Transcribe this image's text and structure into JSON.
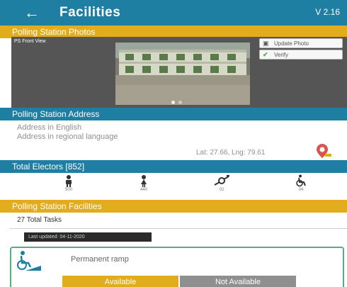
{
  "appbar": {
    "title": "Facilities",
    "version": "V 2.16"
  },
  "photos_section": {
    "title": "Polling Station Photos",
    "caption": "PS Front View",
    "update_label": "Update Photo",
    "verify_label": "Verify",
    "carousel_pages": 2
  },
  "address_section": {
    "title": "Polling Station Address",
    "address_english": "Address in English",
    "address_regional": "Address in regional language",
    "latlng": "Lat: 27.66, Lng: 79.61"
  },
  "electors_section": {
    "title": "Total Electors [852]",
    "male": "500",
    "female": "440",
    "third_gender": "02",
    "pwd": "04"
  },
  "facilities_section": {
    "title": "Polling Station Facilities",
    "total_tasks": "27 Total Tasks",
    "last_updated": "Last updated: 04-11-2020"
  },
  "facility_card": {
    "name": "Permanent ramp",
    "available_label": "Available",
    "not_available_label": "Not Available"
  },
  "colors": {
    "primary": "#1f7fa3",
    "accent": "#e2ad1c",
    "success": "#5bab88",
    "muted": "#8f8f8f"
  },
  "icons": [
    "back-arrow-icon",
    "camera-icon",
    "check-icon",
    "map-pin-icon",
    "male-icon",
    "female-icon",
    "third-gender-icon",
    "wheelchair-icon",
    "ramp-icon"
  ]
}
